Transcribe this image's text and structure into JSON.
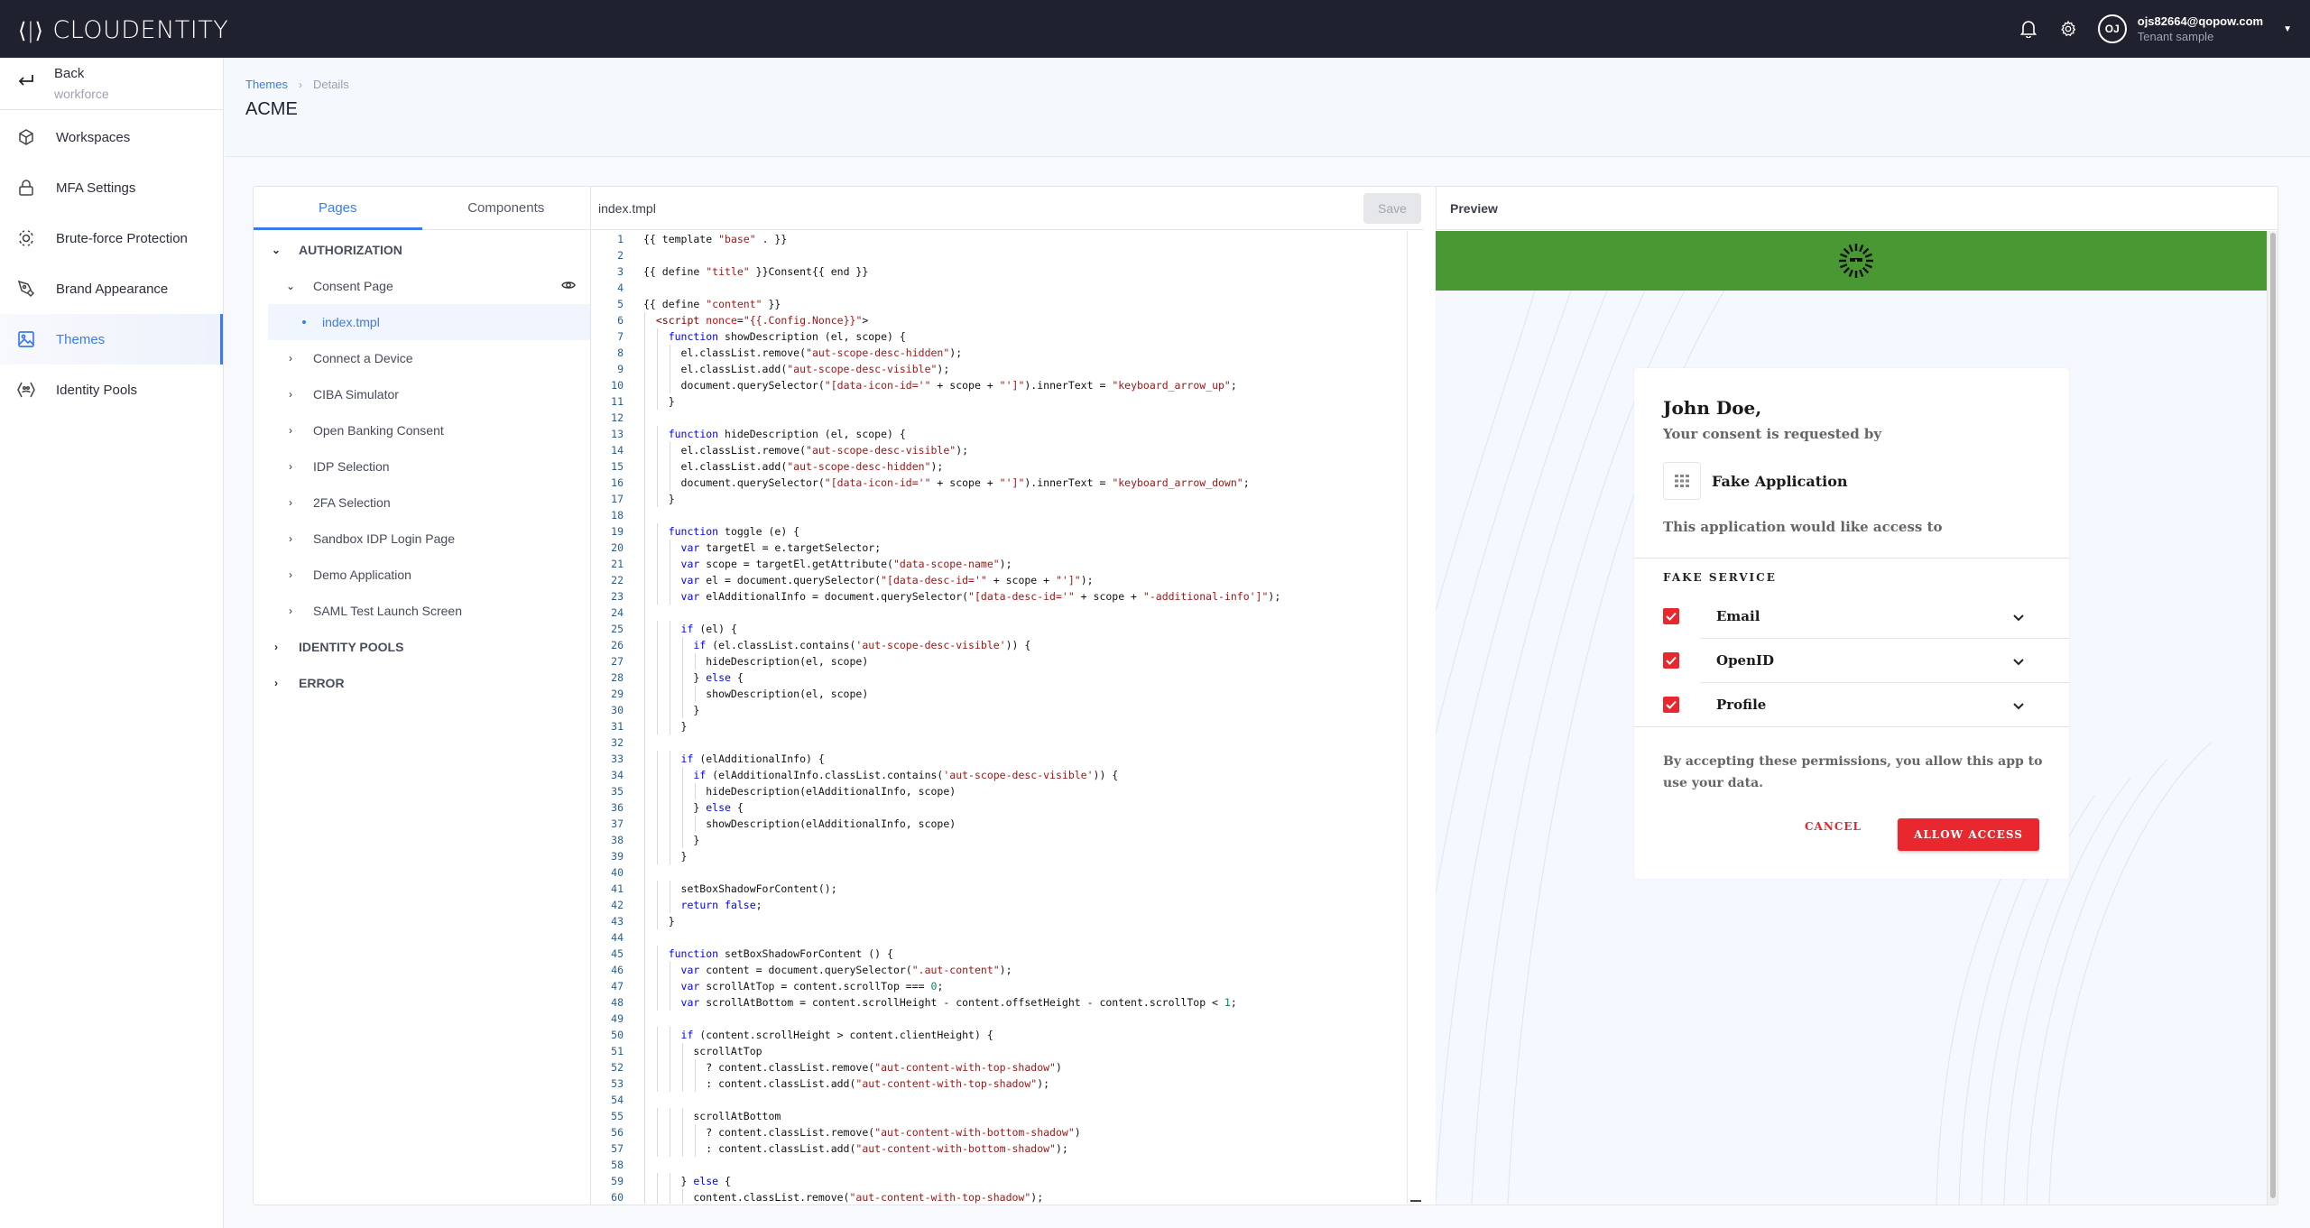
{
  "topbar": {
    "brand": "CLOUDENTITY",
    "user_initials": "OJ",
    "user_email": "ojs82664@qopow.com",
    "tenant": "Tenant sample",
    "icons": [
      "bell-icon",
      "gear-icon",
      "caret-down-icon"
    ]
  },
  "sidebar": {
    "back_label": "Back",
    "back_sub": "workforce",
    "items": [
      {
        "label": "Workspaces",
        "icon": "cube-icon",
        "active": false
      },
      {
        "label": "MFA Settings",
        "icon": "lock-icon",
        "active": false
      },
      {
        "label": "Brute-force Protection",
        "icon": "target-icon",
        "active": false
      },
      {
        "label": "Brand Appearance",
        "icon": "pen-nib-icon",
        "active": false
      },
      {
        "label": "Themes",
        "icon": "image-icon",
        "active": true
      },
      {
        "label": "Identity Pools",
        "icon": "identity-pools-icon",
        "active": false
      }
    ]
  },
  "page": {
    "breadcrumb": [
      "Themes",
      "Details"
    ],
    "title": "ACME"
  },
  "tree": {
    "tabs": [
      {
        "label": "Pages",
        "active": true
      },
      {
        "label": "Components",
        "active": false
      }
    ],
    "sections": [
      {
        "label": "AUTHORIZATION",
        "expanded": true,
        "pages": [
          {
            "label": "Consent Page",
            "expanded": true,
            "files": [
              "index.tmpl"
            ]
          },
          {
            "label": "Connect a Device"
          },
          {
            "label": "CIBA Simulator"
          },
          {
            "label": "Open Banking Consent"
          },
          {
            "label": "IDP Selection"
          },
          {
            "label": "2FA Selection"
          },
          {
            "label": "Sandbox IDP Login Page"
          },
          {
            "label": "Demo Application"
          },
          {
            "label": "SAML Test Launch Screen"
          }
        ]
      },
      {
        "label": "IDENTITY POOLS",
        "expanded": false
      },
      {
        "label": "ERROR",
        "expanded": false
      }
    ],
    "selected_file": "index.tmpl"
  },
  "editor": {
    "filename": "index.tmpl",
    "save_label": "Save",
    "save_disabled": true,
    "lines": [
      "{{ template \"base\" . }}",
      "",
      "{{ define \"title\" }}Consent{{ end }}",
      "",
      "{{ define \"content\" }}",
      "  <script nonce=\"{{.Config.Nonce}}\">",
      "    function showDescription (el, scope) {",
      "      el.classList.remove(\"aut-scope-desc-hidden\");",
      "      el.classList.add(\"aut-scope-desc-visible\");",
      "      document.querySelector(\"[data-icon-id='\" + scope + \"']\").innerText = \"keyboard_arrow_up\";",
      "    }",
      "",
      "    function hideDescription (el, scope) {",
      "      el.classList.remove(\"aut-scope-desc-visible\");",
      "      el.classList.add(\"aut-scope-desc-hidden\");",
      "      document.querySelector(\"[data-icon-id='\" + scope + \"']\").innerText = \"keyboard_arrow_down\";",
      "    }",
      "",
      "    function toggle (e) {",
      "      var targetEl = e.targetSelector;",
      "      var scope = targetEl.getAttribute(\"data-scope-name\");",
      "      var el = document.querySelector(\"[data-desc-id='\" + scope + \"']\");",
      "      var elAdditionalInfo = document.querySelector(\"[data-desc-id='\" + scope + \"-additional-info']\");",
      "",
      "      if (el) {",
      "        if (el.classList.contains('aut-scope-desc-visible')) {",
      "          hideDescription(el, scope)",
      "        } else {",
      "          showDescription(el, scope)",
      "        }",
      "      }",
      "",
      "      if (elAdditionalInfo) {",
      "        if (elAdditionalInfo.classList.contains('aut-scope-desc-visible')) {",
      "          hideDescription(elAdditionalInfo, scope)",
      "        } else {",
      "          showDescription(elAdditionalInfo, scope)",
      "        }",
      "      }",
      "",
      "      setBoxShadowForContent();",
      "      return false;",
      "    }",
      "",
      "    function setBoxShadowForContent () {",
      "      var content = document.querySelector(\".aut-content\");",
      "      var scrollAtTop = content.scrollTop === 0;",
      "      var scrollAtBottom = content.scrollHeight - content.offsetHeight - content.scrollTop < 1;",
      "",
      "      if (content.scrollHeight > content.clientHeight) {",
      "        scrollAtTop",
      "          ? content.classList.remove(\"aut-content-with-top-shadow\")",
      "          : content.classList.add(\"aut-content-with-top-shadow\");",
      "",
      "        scrollAtBottom",
      "          ? content.classList.remove(\"aut-content-with-bottom-shadow\")",
      "          : content.classList.add(\"aut-content-with-bottom-shadow\");",
      "",
      "      } else {",
      "        content.classList.remove(\"aut-content-with-top-shadow\");"
    ]
  },
  "preview": {
    "title": "Preview",
    "banner_color": "#4a9833",
    "user_greeting": "John Doe,",
    "consent_subtitle": "Your consent is requested by",
    "app_name": "Fake Application",
    "access_text": "This application would like access to",
    "service_name": "FAKE SERVICE",
    "scopes": [
      {
        "label": "Email",
        "checked": true
      },
      {
        "label": "OpenID",
        "checked": true
      },
      {
        "label": "Profile",
        "checked": true
      }
    ],
    "note": "By accepting these permissions, you allow this app to use your data.",
    "cancel_label": "CANCEL",
    "allow_label": "ALLOW ACCESS",
    "accent_color": "#e8282e"
  }
}
